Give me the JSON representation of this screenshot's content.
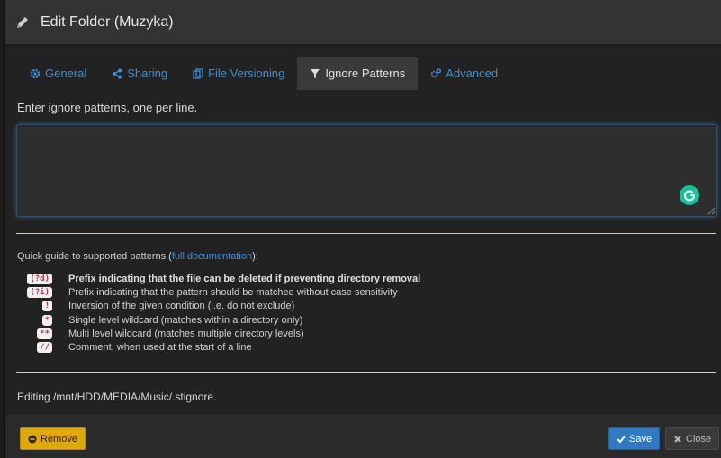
{
  "modal": {
    "title": "Edit Folder (Muzyka)"
  },
  "tabs": [
    {
      "label": "General",
      "icon": "gear-icon",
      "active": false
    },
    {
      "label": "Sharing",
      "icon": "share-icon",
      "active": false
    },
    {
      "label": "File Versioning",
      "icon": "copy-icon",
      "active": false
    },
    {
      "label": "Ignore Patterns",
      "icon": "filter-icon",
      "active": true
    },
    {
      "label": "Advanced",
      "icon": "cogs-icon",
      "active": false
    }
  ],
  "ignore": {
    "intro": "Enter ignore patterns, one per line.",
    "textarea_value": "",
    "guide_prefix": "Quick guide to supported patterns (",
    "guide_link": "full documentation",
    "guide_suffix": "):",
    "patterns": [
      {
        "code": "(?d)",
        "desc": "Prefix indicating that the file can be deleted if preventing directory removal",
        "bold": true
      },
      {
        "code": "(?i)",
        "desc": "Prefix indicating that the pattern should be matched without case sensitivity",
        "bold": false
      },
      {
        "code": "!",
        "desc": "Inversion of the given condition (i.e. do not exclude)",
        "bold": false
      },
      {
        "code": "*",
        "desc": "Single level wildcard (matches within a directory only)",
        "bold": false
      },
      {
        "code": "**",
        "desc": "Multi level wildcard (matches multiple directory levels)",
        "bold": false
      },
      {
        "code": "//",
        "desc": "Comment, when used at the start of a line",
        "bold": false
      }
    ],
    "editing_path": "Editing /mnt/HDD/MEDIA/Music/.stignore."
  },
  "footer": {
    "remove_label": "Remove",
    "save_label": "Save",
    "close_label": "Close"
  },
  "colors": {
    "accent": "#3a8fd6",
    "save": "#2e7bc4",
    "remove": "#e0a80a",
    "code_text": "#c7254e",
    "grammarly": "#15c39a"
  }
}
